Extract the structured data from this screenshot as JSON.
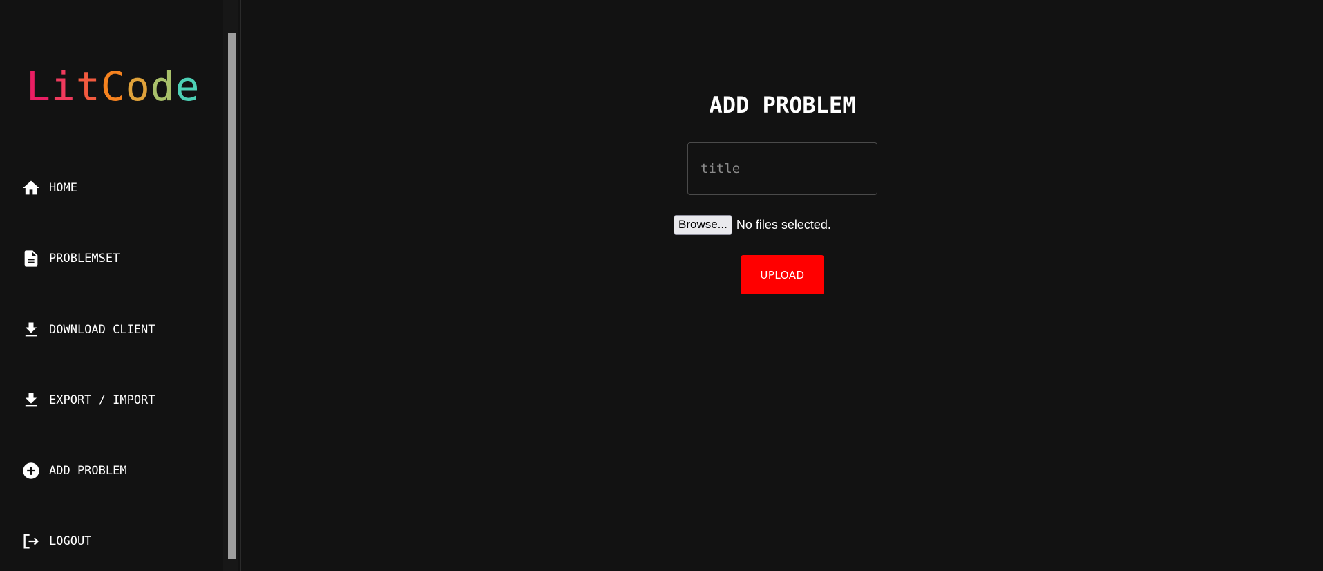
{
  "app": {
    "logo_letters": [
      {
        "char": "L",
        "color": "#e91e63"
      },
      {
        "char": "i",
        "color": "#ef3a5d"
      },
      {
        "char": "t",
        "color": "#f25a3f"
      },
      {
        "char": "C",
        "color": "#f5821f"
      },
      {
        "char": "o",
        "color": "#e0a23a"
      },
      {
        "char": "d",
        "color": "#a8c06a"
      },
      {
        "char": "e",
        "color": "#4dd0b5"
      }
    ]
  },
  "sidebar": {
    "items": [
      {
        "label": "HOME",
        "icon": "home-icon"
      },
      {
        "label": "PROBLEMSET",
        "icon": "document-icon"
      },
      {
        "label": "DOWNLOAD CLIENT",
        "icon": "download-icon"
      },
      {
        "label": "EXPORT / IMPORT",
        "icon": "download-icon"
      },
      {
        "label": "ADD PROBLEM",
        "icon": "add-circle-icon"
      },
      {
        "label": "LOGOUT",
        "icon": "logout-icon"
      }
    ]
  },
  "main": {
    "title": "ADD PROBLEM",
    "title_input": {
      "placeholder": "title",
      "value": ""
    },
    "file_input": {
      "button_label": "Browse...",
      "status": "No files selected."
    },
    "upload_label": "UPLOAD"
  },
  "colors": {
    "background": "#121212",
    "accent": "#ff0000",
    "text": "#ffffff"
  }
}
